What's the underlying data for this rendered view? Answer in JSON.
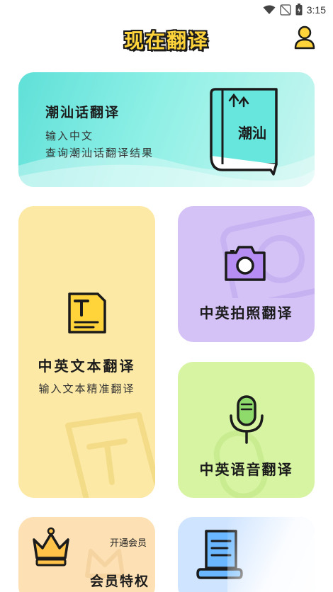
{
  "status_bar": {
    "time": "3:15"
  },
  "header": {
    "title": "现在翻译"
  },
  "cards": {
    "chaoshan": {
      "title": "潮汕话翻译",
      "subtitle_line1": "输入中文",
      "subtitle_line2": "查询潮汕话翻译结果",
      "book_label": "潮汕"
    },
    "text": {
      "title": "中英文本翻译",
      "subtitle": "输入文本精准翻译"
    },
    "photo": {
      "title": "中英拍照翻译"
    },
    "voice": {
      "title": "中英语音翻译"
    },
    "vip": {
      "open_label": "开通会员",
      "title": "会员特权"
    }
  },
  "icons": {
    "wifi": "wifi-icon",
    "signal": "signal-off-icon",
    "battery": "battery-icon",
    "user": "user-icon",
    "book": "book-icon",
    "text": "text-document-icon",
    "camera": "camera-icon",
    "mic": "microphone-icon",
    "crown": "crown-icon",
    "doc": "document-scroll-icon"
  },
  "colors": {
    "accent_yellow": "#ffd43b",
    "teal_card": "#5fe0d8",
    "text_card": "#fde9a6",
    "photo_card": "#d4c2f7",
    "voice_card": "#d6f4a2",
    "vip_card": "#fde1b4",
    "doc_card": "#cfe4ff"
  }
}
